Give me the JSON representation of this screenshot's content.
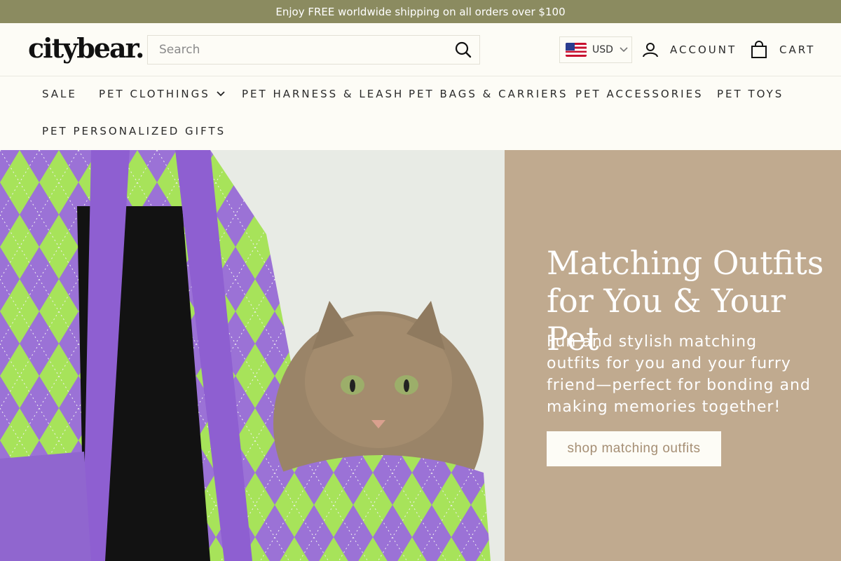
{
  "announcement": "Enjoy FREE worldwide shipping on all orders over $100",
  "header": {
    "logo": "citybear.",
    "search_placeholder": "Search",
    "currency": "USD",
    "account": "ACCOUNT",
    "cart": "CART"
  },
  "nav": {
    "items": [
      {
        "label": "SALE"
      },
      {
        "label": "PET CLOTHINGS"
      },
      {
        "label": "PET HARNESS & LEASH"
      },
      {
        "label": "PET BAGS & CARRIERS"
      },
      {
        "label": "PET ACCESSORIES"
      },
      {
        "label": "PET TOYS"
      },
      {
        "label": "PET PERSONALIZED GIFTS"
      }
    ]
  },
  "hero": {
    "title_line1": "Matching Outfits",
    "title_line2": "for You & Your Pet",
    "text": "Fun and stylish matching outfits for you and your furry friend—perfect for bonding and making memories together!",
    "button": "shop matching outfits"
  },
  "colors": {
    "announcement_bg": "#8b8b60",
    "hero_panel_bg": "#c0aa8f",
    "button_text": "#a58e74",
    "page_bg": "#fdfcf6"
  }
}
